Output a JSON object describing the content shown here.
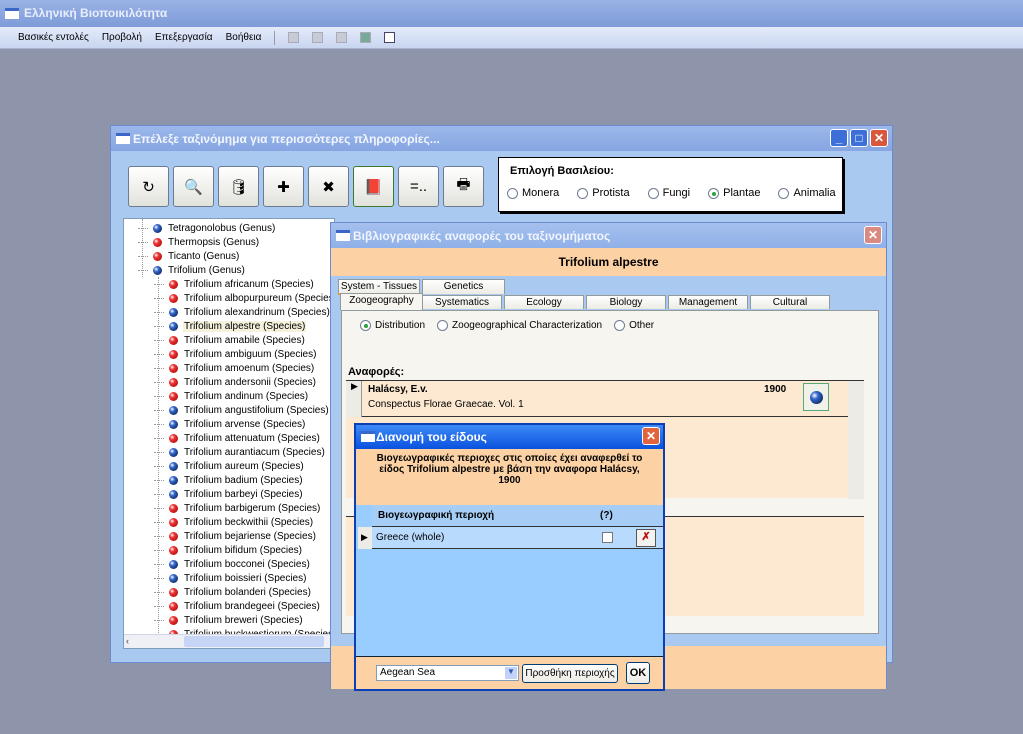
{
  "app": {
    "title": "Ελληνική Βιοποικιλότητα"
  },
  "menu": [
    "Βασικές εντολές",
    "Προβολή",
    "Επεξεργασία",
    "Βοήθεια"
  ],
  "toolbar_icons": [
    "cut-icon",
    "copy-icon",
    "paste-icon",
    "print-icon",
    "report-icon"
  ],
  "taxa_window": {
    "title": "Επέλεξε ταξινόμημα για περισσότερες πληροφορίες...",
    "tools": [
      {
        "name": "refresh-icon",
        "glyph": "↻"
      },
      {
        "name": "search-taxa-icon",
        "glyph": "🔍"
      },
      {
        "name": "database-edit-icon",
        "glyph": "🛢"
      },
      {
        "name": "add-taxon-icon",
        "glyph": "✚"
      },
      {
        "name": "delete-taxon-icon",
        "glyph": "✖"
      },
      {
        "name": "book-icon",
        "glyph": "📕"
      },
      {
        "name": "equals-icon",
        "glyph": "=.."
      },
      {
        "name": "print-icon",
        "glyph": "🖶"
      }
    ],
    "kingdom": {
      "label": "Επιλογή Βασιλείου:",
      "options": [
        "Monera",
        "Protista",
        "Fungi",
        "Plantae",
        "Animalia"
      ],
      "selected": "Plantae"
    },
    "tree": [
      {
        "label": "Tetragonolobus  (Genus)",
        "color": "blue",
        "level": 0
      },
      {
        "label": "Thermopsis  (Genus)",
        "color": "red",
        "level": 0
      },
      {
        "label": "Ticanto  (Genus)",
        "color": "red",
        "level": 0
      },
      {
        "label": "Trifolium  (Genus)",
        "color": "blue",
        "level": 0
      },
      {
        "label": "Trifolium africanum  (Species)",
        "color": "red",
        "level": 1
      },
      {
        "label": "Trifolium albopurpureum  (Species)",
        "color": "red",
        "level": 1
      },
      {
        "label": "Trifolium alexandrinum  (Species)",
        "color": "blue",
        "level": 1
      },
      {
        "label": "Trifolium alpestre  (Species)",
        "color": "blue",
        "level": 1,
        "selected": true
      },
      {
        "label": "Trifolium amabile  (Species)",
        "color": "red",
        "level": 1
      },
      {
        "label": "Trifolium ambiguum  (Species)",
        "color": "red",
        "level": 1
      },
      {
        "label": "Trifolium amoenum  (Species)",
        "color": "red",
        "level": 1
      },
      {
        "label": "Trifolium andersonii  (Species)",
        "color": "red",
        "level": 1
      },
      {
        "label": "Trifolium andinum  (Species)",
        "color": "red",
        "level": 1
      },
      {
        "label": "Trifolium angustifolium  (Species)",
        "color": "blue",
        "level": 1
      },
      {
        "label": "Trifolium arvense  (Species)",
        "color": "blue",
        "level": 1
      },
      {
        "label": "Trifolium attenuatum  (Species)",
        "color": "red",
        "level": 1
      },
      {
        "label": "Trifolium aurantiacum  (Species)",
        "color": "blue",
        "level": 1
      },
      {
        "label": "Trifolium aureum  (Species)",
        "color": "blue",
        "level": 1
      },
      {
        "label": "Trifolium badium  (Species)",
        "color": "blue",
        "level": 1
      },
      {
        "label": "Trifolium barbeyi  (Species)",
        "color": "blue",
        "level": 1
      },
      {
        "label": "Trifolium barbigerum  (Species)",
        "color": "red",
        "level": 1
      },
      {
        "label": "Trifolium beckwithii  (Species)",
        "color": "red",
        "level": 1
      },
      {
        "label": "Trifolium bejariense  (Species)",
        "color": "red",
        "level": 1
      },
      {
        "label": "Trifolium bifidum  (Species)",
        "color": "red",
        "level": 1
      },
      {
        "label": "Trifolium bocconei  (Species)",
        "color": "blue",
        "level": 1
      },
      {
        "label": "Trifolium boissieri  (Species)",
        "color": "blue",
        "level": 1
      },
      {
        "label": "Trifolium bolanderi  (Species)",
        "color": "red",
        "level": 1
      },
      {
        "label": "Trifolium brandegeei  (Species)",
        "color": "red",
        "level": 1
      },
      {
        "label": "Trifolium breweri  (Species)",
        "color": "red",
        "level": 1
      },
      {
        "label": "Trifolium buckwestiorum  (Species)",
        "color": "red",
        "level": 1
      }
    ]
  },
  "refs_window": {
    "title": "Βιβλιογραφικές αναφορές του ταξινομήματος",
    "taxon": "Trifolium alpestre",
    "tabs_back": [
      "System - Tissues",
      "Genetics"
    ],
    "tabs_front": [
      "Zoogeography",
      "Systematics",
      "Ecology",
      "Biology",
      "Management",
      "Cultural"
    ],
    "active_tab": "Zoogeography",
    "options": [
      "Distribution",
      "Zoogeographical Characterization",
      "Other"
    ],
    "selected_option": "Distribution",
    "refs_label": "Αναφορές:",
    "reference": {
      "author": "Halácsy, E.v.",
      "year": "1900",
      "title": "Conspectus Florae Graecae. Vol. 1"
    }
  },
  "dialog": {
    "title": "Διανομή του είδους",
    "header": "Βιογεωγραφικές περιοχες στις οποίες έχει αναφερθεί το είδος Trifolium alpestre με βάση την αναφορα Halácsy, 1900",
    "col_region": "Βιογεωγραφική περιοχή",
    "col_uncertain": "(?)",
    "rows": [
      {
        "region": "Greece (whole)",
        "uncertain": false
      }
    ],
    "combo_value": "Aegean Sea",
    "add_button": "Προσθήκη περιοχής",
    "ok_button": "OK"
  },
  "colors": {
    "desktop": "#8e95aa",
    "window_body": "#a9c9f1",
    "header_orange": "#fcd2a4",
    "dialog_body": "#99ccff"
  }
}
